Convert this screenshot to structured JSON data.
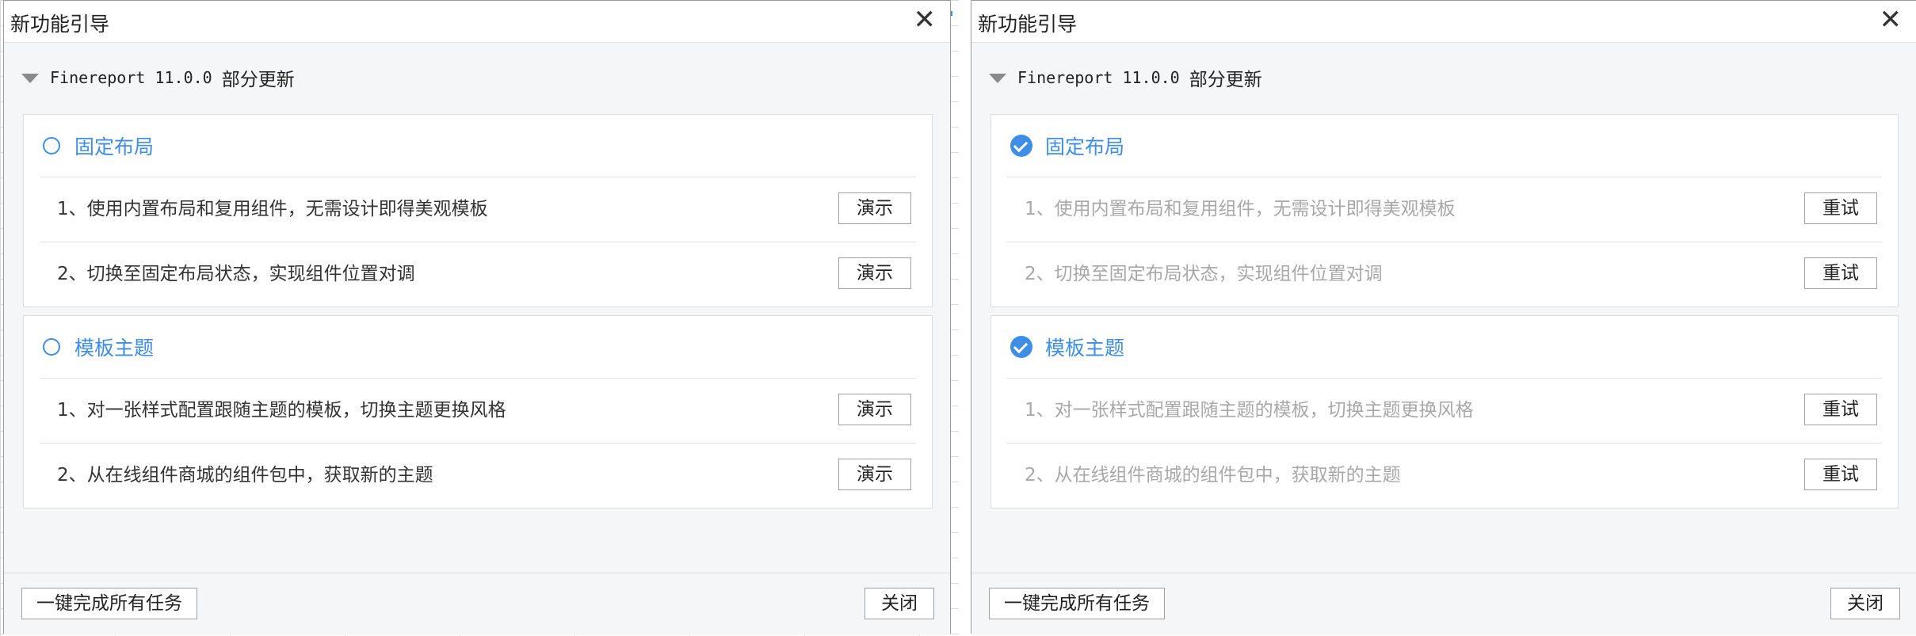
{
  "dialogs": [
    {
      "title": "新功能引导",
      "close_icon": "close-icon",
      "version": "Finereport 11.0.0",
      "version_suffix": "部分更新",
      "groups": [
        {
          "title": "固定布局",
          "completed": false,
          "tasks": [
            {
              "label": "1、使用内置布局和复用组件，无需设计即得美观模板",
              "button": "演示"
            },
            {
              "label": "2、切换至固定布局状态，实现组件位置对调",
              "button": "演示"
            }
          ]
        },
        {
          "title": "模板主题",
          "completed": false,
          "tasks": [
            {
              "label": "1、对一张样式配置跟随主题的模板，切换主题更换风格",
              "button": "演示"
            },
            {
              "label": "2、从在线组件商城的组件包中，获取新的主题",
              "button": "演示"
            }
          ]
        }
      ],
      "complete_all": "一键完成所有任务",
      "close_label": "关闭"
    },
    {
      "title": "新功能引导",
      "close_icon": "close-icon",
      "version": "Finereport 11.0.0",
      "version_suffix": "部分更新",
      "groups": [
        {
          "title": "固定布局",
          "completed": true,
          "tasks": [
            {
              "label": "1、使用内置布局和复用组件，无需设计即得美观模板",
              "button": "重试"
            },
            {
              "label": "2、切换至固定布局状态，实现组件位置对调",
              "button": "重试"
            }
          ]
        },
        {
          "title": "模板主题",
          "completed": true,
          "tasks": [
            {
              "label": "1、对一张样式配置跟随主题的模板，切换主题更换风格",
              "button": "重试"
            },
            {
              "label": "2、从在线组件商城的组件包中，获取新的主题",
              "button": "重试"
            }
          ]
        }
      ],
      "complete_all": "一键完成所有任务",
      "close_label": "关闭"
    }
  ],
  "colors": {
    "accent": "#3e8ee6",
    "completed_text": "#a8a8a8",
    "dialog_bg": "#f5f6f7"
  }
}
